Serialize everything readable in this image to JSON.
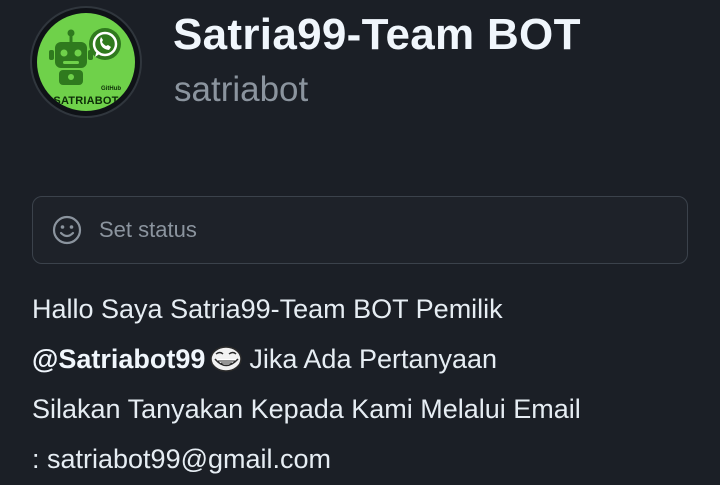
{
  "profile": {
    "display_name": "Satria99-Team BOT",
    "username": "satriabot",
    "avatar": {
      "brand_text": "SATRIABOT",
      "github_text": "GitHub",
      "icons": [
        "robot-icon",
        "whatsapp-icon"
      ],
      "bg_color": "#6fd14a"
    }
  },
  "status": {
    "label": "Set status",
    "icon": "smiley-icon"
  },
  "bio": {
    "line1": "Hallo Saya Satria99-Team BOT Pemilik",
    "mention": "@Satriabot99",
    "emoji": "troll-face-icon",
    "line2_rest": "Jika Ada Pertanyaan",
    "line3": "Silakan Tanyakan Kepada Kami Melalui Email",
    "line4": ": satriabot99@gmail.com"
  },
  "colors": {
    "background": "#1b1f26",
    "text": "#e6edf3",
    "muted": "#8b949e",
    "border": "#3b424b"
  }
}
